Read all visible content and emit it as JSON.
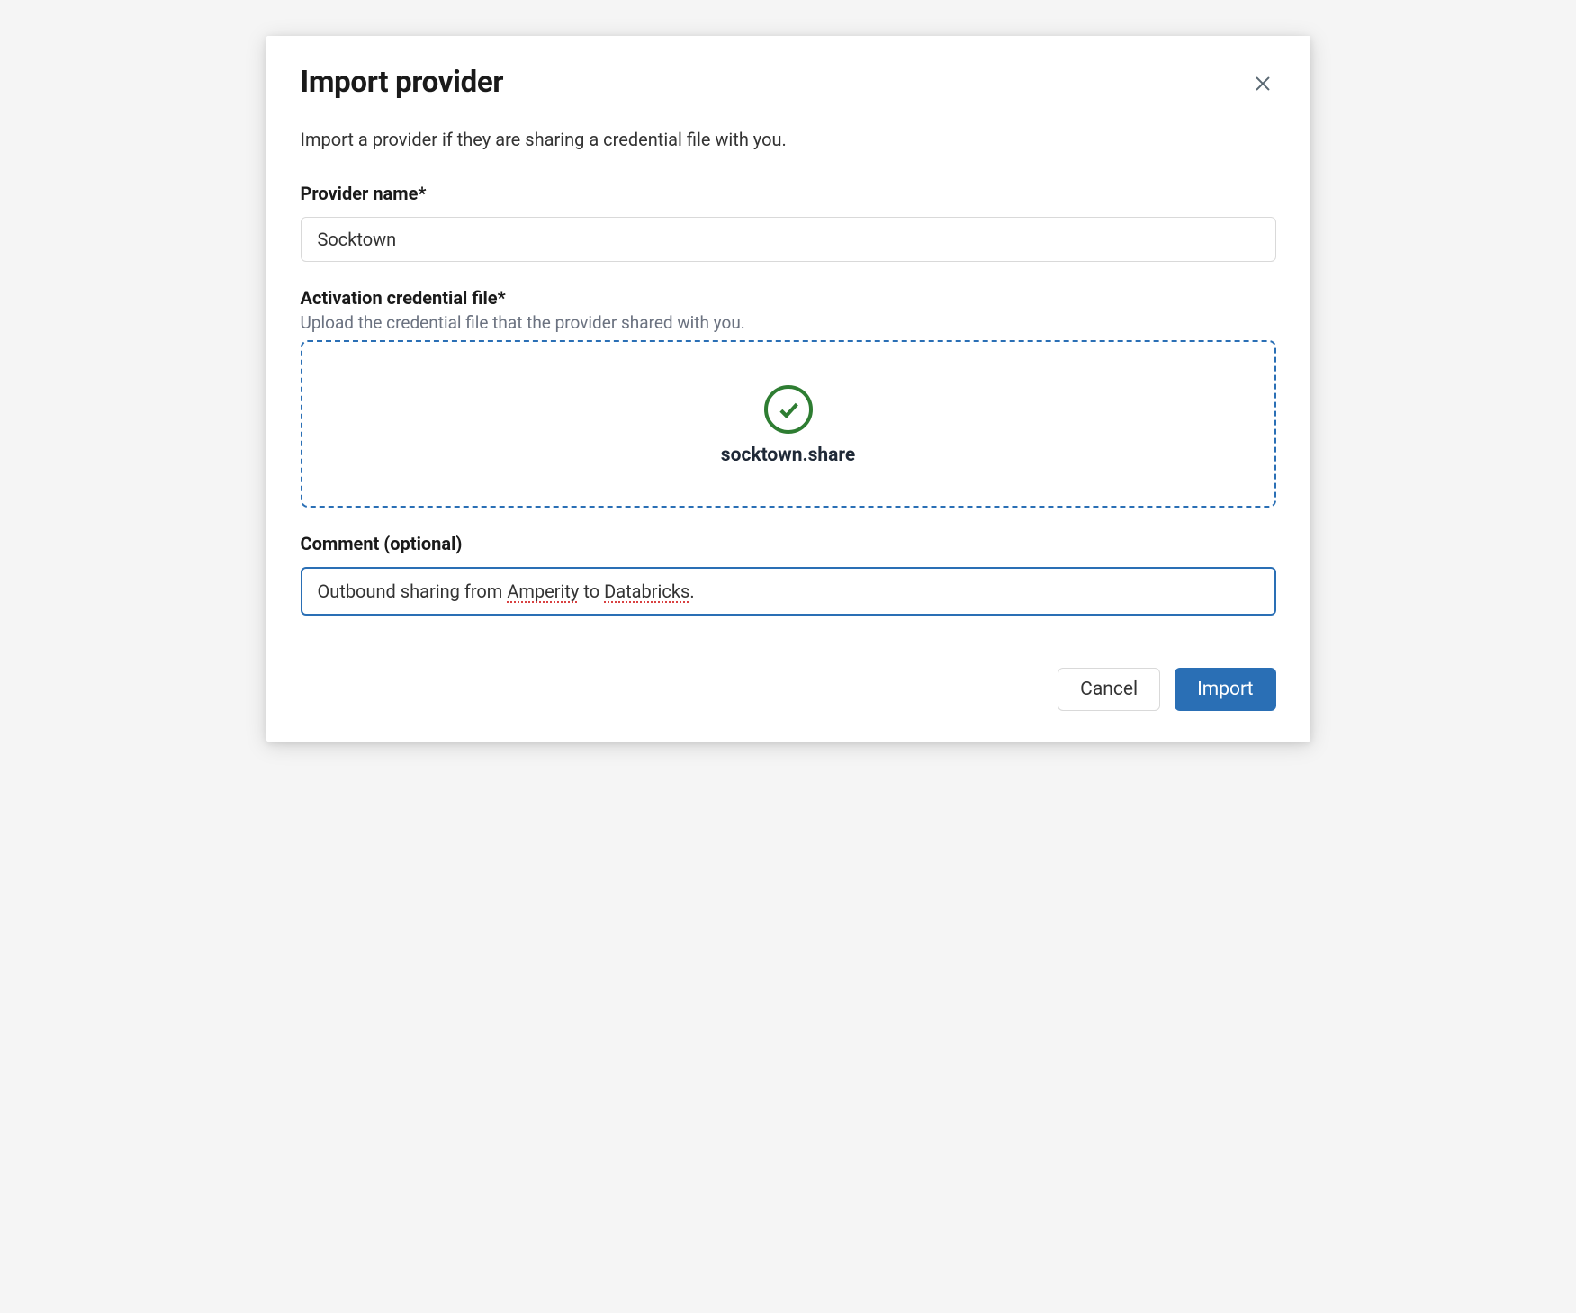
{
  "dialog": {
    "title": "Import provider",
    "description": "Import a provider if they are sharing a credential file with you."
  },
  "fields": {
    "providerName": {
      "label": "Provider name*",
      "value": "Socktown"
    },
    "credentialFile": {
      "label": "Activation credential file*",
      "hint": "Upload the credential file that the provider shared with you.",
      "uploadedFilename": "socktown.share"
    },
    "comment": {
      "label": "Comment (optional)",
      "value_prefix": "Outbound sharing from ",
      "value_word1": "Amperity",
      "value_mid": " to ",
      "value_word2": "Databricks",
      "value_suffix": "."
    }
  },
  "footer": {
    "cancel": "Cancel",
    "import": "Import"
  }
}
